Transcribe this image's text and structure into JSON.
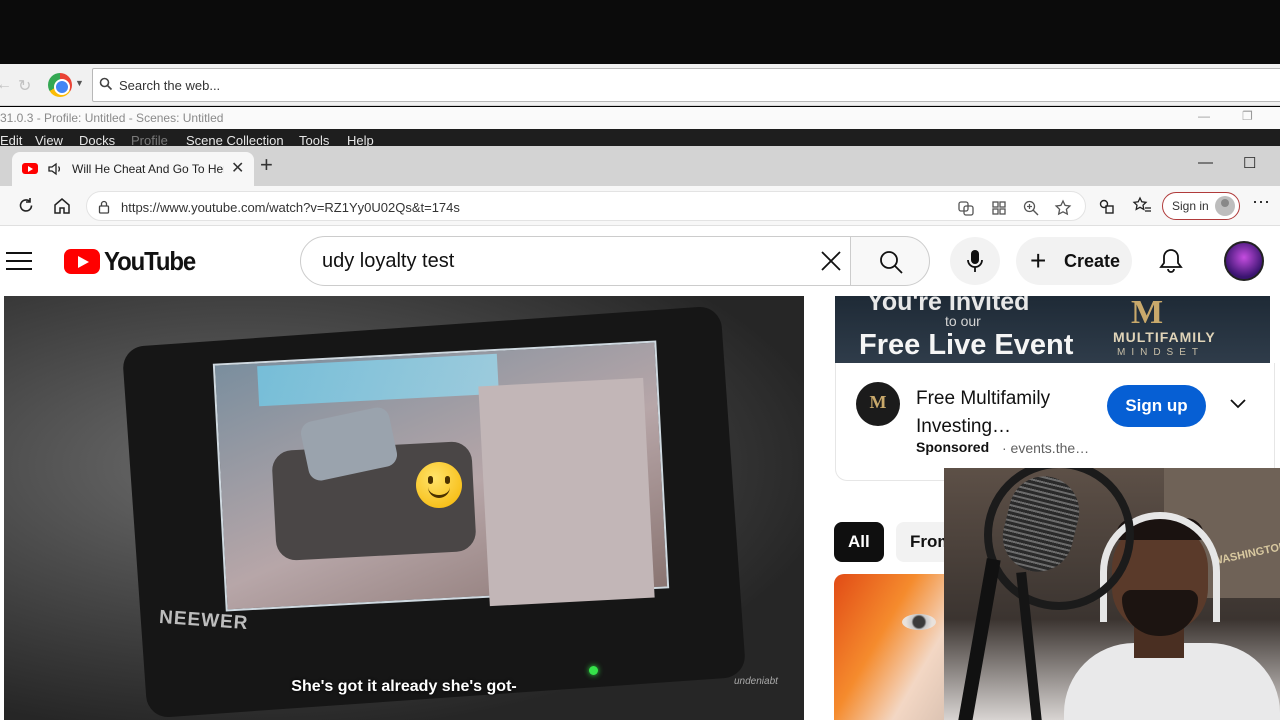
{
  "outer_browser": {
    "search_placeholder": "Search the web..."
  },
  "obs": {
    "title": "31.0.3 - Profile: Untitled - Scenes: Untitled",
    "menu": [
      "Edit",
      "View",
      "Docks",
      "Profile",
      "Scene Collection",
      "Tools",
      "Help"
    ],
    "min_glyph": "—",
    "restore_glyph": "❐"
  },
  "edge": {
    "tab_title": "Will He Cheat And Go To Her",
    "tab_close": "✕",
    "new_tab": "+",
    "url": "https://www.youtube.com/watch?v=RZ1Yy0U02Qs&t=174s",
    "sign_in": "Sign in",
    "menu_glyph": "⋯",
    "min_glyph": "—",
    "max_glyph": "☐"
  },
  "youtube": {
    "logo_text": "YouTube",
    "search_value": "udy loyalty test",
    "create_label": "Create",
    "chips": [
      "All",
      "From"
    ]
  },
  "video": {
    "caption": "She's got it already she's got-",
    "brand": "NEEWER",
    "watermark": "undeniabt"
  },
  "ad": {
    "banner_line1": "You're Invited",
    "banner_line2": "to our",
    "banner_line3": "Free Live Event",
    "brand_mark": "M",
    "brand_name": "MULTIFAMILY",
    "brand_sub": "MINDSET",
    "title": "Free Multifamily Investing…",
    "sponsored": "Sponsored",
    "domain": "· events.the…",
    "cta": "Sign up"
  },
  "webcam": {
    "sign_text": "WASHINGTON"
  },
  "colors": {
    "youtube_red": "#ff0000",
    "cta_blue": "#065fd4",
    "obs_menu_bg": "#1e1e1e"
  }
}
